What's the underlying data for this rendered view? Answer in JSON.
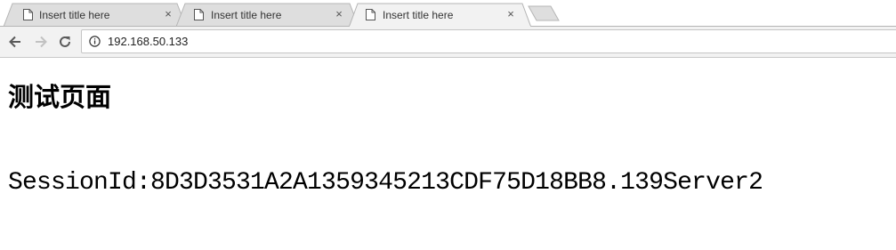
{
  "browser": {
    "tabs": [
      {
        "title": "Insert title here",
        "close": "×",
        "active": false
      },
      {
        "title": "Insert title here",
        "close": "×",
        "active": false
      },
      {
        "title": "Insert title here",
        "close": "×",
        "active": true
      }
    ],
    "address": {
      "url": "192.168.50.133"
    }
  },
  "page": {
    "heading": "测试页面",
    "session_text": "SessionId:8D3D3531A2A1359345213CDF75D18BB8.139Server2"
  },
  "colors": {
    "tab_inactive": "#dedede",
    "tab_active": "#f2f2f2",
    "toolbar": "#f2f2f2",
    "border": "#b5b5b5"
  }
}
